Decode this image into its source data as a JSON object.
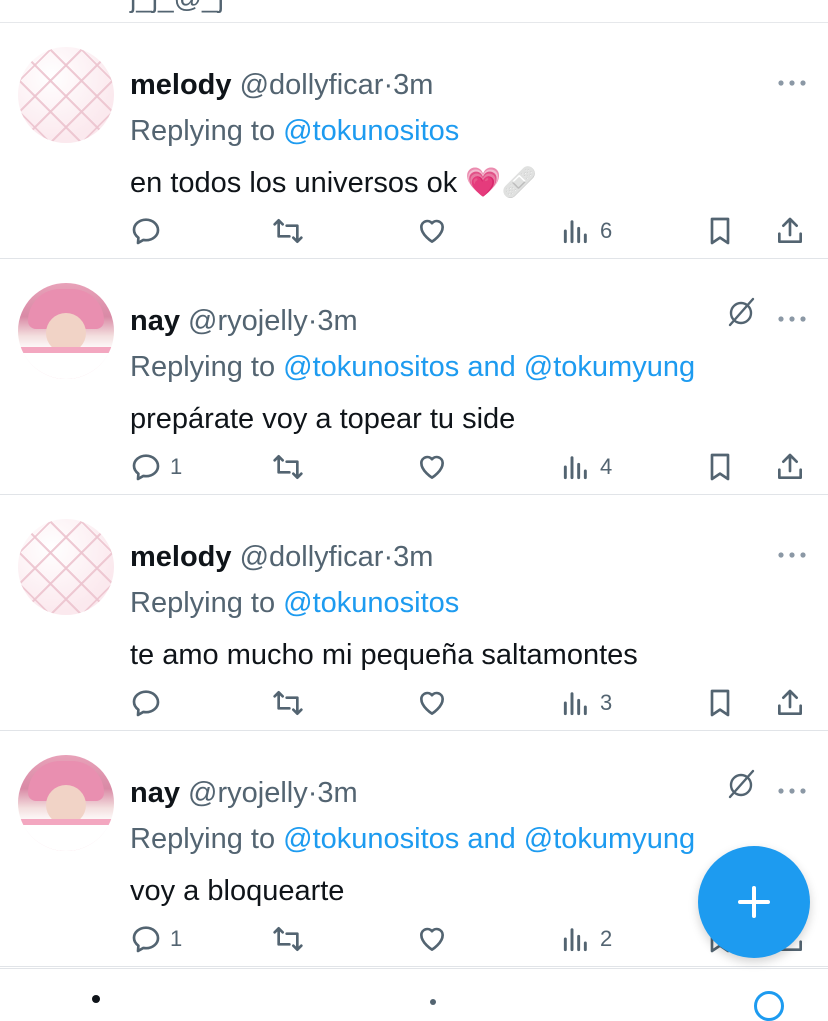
{
  "tweets": [
    {
      "name": "melody",
      "handle": "@dollyficar",
      "dot": "·",
      "time": "3m",
      "replying_prefix": "Replying to ",
      "mentions": "@tokunositos",
      "text": "en todos los universos ok 💗🩹",
      "avatar": "quilted-pink",
      "muted_icon": false,
      "actions": {
        "reply": "",
        "retweet": "",
        "like": "",
        "views": "6"
      }
    },
    {
      "name": "nay",
      "handle": "@ryojelly",
      "dot": "·",
      "time": "3m",
      "replying_prefix": "Replying to ",
      "mentions": "@tokunositos and @tokumyung",
      "text": "prepárate voy a topear tu side",
      "avatar": "photo-pink-hair",
      "muted_icon": true,
      "actions": {
        "reply": "1",
        "retweet": "",
        "like": "",
        "views": "4"
      }
    },
    {
      "name": "melody",
      "handle": "@dollyficar",
      "dot": "·",
      "time": "3m",
      "replying_prefix": "Replying to ",
      "mentions": "@tokunositos",
      "text": "te amo mucho mi pequeña saltamontes",
      "avatar": "quilted-pink",
      "muted_icon": false,
      "actions": {
        "reply": "",
        "retweet": "",
        "like": "",
        "views": "3"
      }
    },
    {
      "name": "nay",
      "handle": "@ryojelly",
      "dot": "·",
      "time": "3m",
      "replying_prefix": "Replying to ",
      "mentions": "@tokunositos and @tokumyung",
      "text": "voy a bloquearte",
      "avatar": "photo-pink-hair",
      "muted_icon": true,
      "actions": {
        "reply": "1",
        "retweet": "",
        "like": "",
        "views": "2"
      }
    }
  ],
  "icons": {
    "reply": "reply-icon",
    "retweet": "retweet-icon",
    "like": "like-icon",
    "views": "views-icon",
    "bookmark": "bookmark-icon",
    "share": "share-icon",
    "more": "more-icon",
    "muted": "muted-icon",
    "compose": "compose-icon"
  },
  "colors": {
    "accent": "#1d9bf0",
    "text": "#0f1419",
    "secondary": "#536471",
    "divider": "#e1e4e8"
  }
}
